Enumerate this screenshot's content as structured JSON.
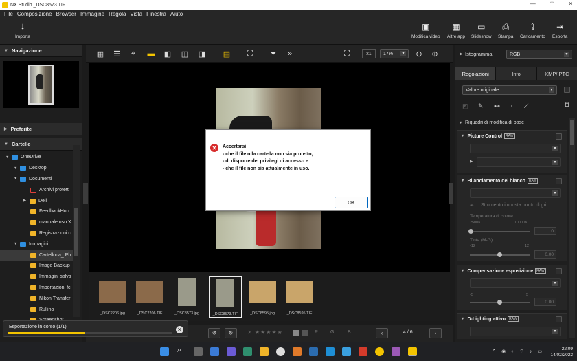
{
  "window": {
    "title": "NX Studio   _DSC8573.TIF",
    "controls": [
      "—",
      "▢",
      "✕"
    ]
  },
  "menu": [
    "File",
    "Composizione",
    "Browser",
    "Immagine",
    "Regola",
    "Vista",
    "Finestra",
    "Aiuto"
  ],
  "toolbar": {
    "import_label": "Importa",
    "right_buttons": [
      "Modifica video",
      "Altre app",
      "Slideshow",
      "Stampa",
      "Caricamento",
      "Esporta"
    ]
  },
  "left_panel": {
    "navigation_title": "Navigazione",
    "favorites_title": "Preferite",
    "folders_title": "Cartelle",
    "tree": [
      {
        "label": "OneDrive",
        "icon": "cloud-folder"
      },
      {
        "label": "Desktop",
        "icon": "blue-folder"
      },
      {
        "label": "Documenti",
        "icon": "blue-folder"
      },
      {
        "label": "Archivi protett",
        "icon": "lock-folder"
      },
      {
        "label": "Dell",
        "icon": "folder"
      },
      {
        "label": "FeedbackHub",
        "icon": "folder"
      },
      {
        "label": "manuale uso X",
        "icon": "folder"
      },
      {
        "label": "Registrazioni c",
        "icon": "folder"
      },
      {
        "label": "Immagini",
        "icon": "blue-folder"
      },
      {
        "label": "Cartellona_ Ph",
        "icon": "folder"
      },
      {
        "label": "Image Backup",
        "icon": "folder"
      },
      {
        "label": "Immagini salva",
        "icon": "folder"
      },
      {
        "label": "Importazioni fc",
        "icon": "folder"
      },
      {
        "label": "Nikon Transfer",
        "icon": "folder"
      },
      {
        "label": "Rullino",
        "icon": "folder"
      },
      {
        "label": "Screenshot",
        "icon": "folder"
      }
    ]
  },
  "viewer_bar": {
    "zoom_factor": "x1",
    "zoom_percent": "17%"
  },
  "filmstrip": [
    {
      "name": "_DSC2206.jpg",
      "thumb": "#8b6a4a"
    },
    {
      "name": "_DSC2206.TIF",
      "thumb": "#8b6a4a"
    },
    {
      "name": "_DSC8573.jpg",
      "thumb": "#9a9a8a"
    },
    {
      "name": "_DSC8573.TIF",
      "thumb": "#9a9a8a"
    },
    {
      "name": "_DSC8595.jpg",
      "thumb": "#c9a56a"
    },
    {
      "name": "_DSC8595.TIF",
      "thumb": "#c9a56a"
    }
  ],
  "status": {
    "page": "4 / 6",
    "r_label": "R:",
    "g_label": "G:",
    "b_label": "B:"
  },
  "progress": {
    "label": "Esportazione in corso (1/1)",
    "fraction": 0.47
  },
  "right_panel": {
    "histogram_label": "Istogramma",
    "histogram_channel": "RGB",
    "tabs": [
      "Regolazioni",
      "Info",
      "XMP/IPTC"
    ],
    "preset_value": "Valore originale",
    "basic_section": "Riquadri di modifica di base",
    "sections": {
      "picture_control": "Picture Control",
      "white_balance": "Bilanciamento del bianco",
      "wb_point_tool": "Strumento imposta punto di gri...",
      "color_temp_label": "Temperatura di colore",
      "temp_min": "2500K",
      "temp_max": "10000K",
      "temp_value": "0",
      "tint_label": "Tinta (M-G)",
      "tint_min": "-12",
      "tint_max": "12",
      "tint_value": "0.00",
      "exposure": "Compensazione esposizione",
      "exp_min": "-5",
      "exp_max": "5",
      "exp_value": "0.00",
      "adl": "D-Lighting attivo",
      "raw_badge": "RAW"
    }
  },
  "dialog": {
    "title": "Accertarsi",
    "lines": [
      "- che il file o la cartella non sia protetto,",
      "- di disporre dei privilegi di accesso e",
      "- che il file non sia attualmente in uso."
    ],
    "ok_label": "OK"
  },
  "taskbar": {
    "time": "22:09",
    "date": "14/02/2022"
  }
}
